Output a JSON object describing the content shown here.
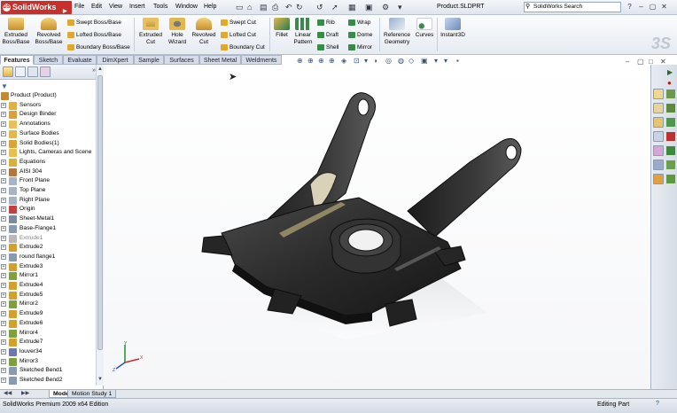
{
  "app": {
    "logo": "SolidWorks",
    "document_title": "Product.SLDPRT"
  },
  "menu": [
    "File",
    "Edit",
    "View",
    "Insert",
    "Tools",
    "Window",
    "Help"
  ],
  "search": {
    "placeholder": "SolidWorks Search"
  },
  "ribbon": {
    "extruded_boss": "Extruded Boss/Base",
    "revolved_boss": "Revolved Boss/Base",
    "swept_boss": "Swept Boss/Base",
    "lofted_boss": "Lofted Boss/Base",
    "boundary_boss": "Boundary Boss/Base",
    "extruded_cut": "Extruded Cut",
    "hole_wizard": "Hole Wizard",
    "revolved_cut": "Revolved Cut",
    "swept_cut": "Swept Cut",
    "lofted_cut": "Lofted Cut",
    "boundary_cut": "Boundary Cut",
    "fillet": "Fillet",
    "linear_pattern": "Linear Pattern",
    "rib": "Rib",
    "draft": "Draft",
    "shell": "Shell",
    "wrap": "Wrap",
    "dome": "Dome",
    "mirror": "Mirror",
    "reference_geometry": "Reference Geometry",
    "curves": "Curves",
    "instant3d": "Instant3D"
  },
  "tabs": [
    "Features",
    "Sketch",
    "Evaluate",
    "DimXpert",
    "Sample",
    "Surfaces",
    "Sheet Metal",
    "Weldments"
  ],
  "tree": [
    {
      "label": "Product  (Product)",
      "icon": "part-icon",
      "color": "#c88a2a",
      "root": true
    },
    {
      "label": "Sensors",
      "icon": "sensor-icon",
      "color": "#e0b040"
    },
    {
      "label": "Design Binder",
      "icon": "binder-icon",
      "color": "#d9a040"
    },
    {
      "label": "Annotations",
      "icon": "annotation-icon",
      "color": "#e6c05a"
    },
    {
      "label": "Surface Bodies",
      "icon": "surface-body-icon",
      "color": "#e2b84c"
    },
    {
      "label": "Solid Bodies(1)",
      "icon": "solid-body-icon",
      "color": "#d9a43c"
    },
    {
      "label": "Lights, Cameras and Scene",
      "icon": "lights-icon",
      "color": "#e5c050"
    },
    {
      "label": "Equations",
      "icon": "equation-icon",
      "color": "#d8b040"
    },
    {
      "label": "AISI 304",
      "icon": "material-icon",
      "color": "#b07840"
    },
    {
      "label": "Front Plane",
      "icon": "plane-icon",
      "color": "#a8b4c4"
    },
    {
      "label": "Top Plane",
      "icon": "plane-icon",
      "color": "#a8b4c4"
    },
    {
      "label": "Right Plane",
      "icon": "plane-icon",
      "color": "#a8b4c4"
    },
    {
      "label": "Origin",
      "icon": "origin-icon",
      "color": "#c04040"
    },
    {
      "label": "Sheet-Metal1",
      "icon": "sheet-metal-icon",
      "color": "#7a8aa0"
    },
    {
      "label": "Base-Flange1",
      "icon": "flange-icon",
      "color": "#8a9ab0"
    },
    {
      "label": "Extrude1",
      "icon": "extrude-icon",
      "color": "#b8b8b8",
      "dim": true
    },
    {
      "label": "Extrude2",
      "icon": "extrude-icon",
      "color": "#d0a030"
    },
    {
      "label": "round flange1",
      "icon": "flange-icon",
      "color": "#8a9ab0"
    },
    {
      "label": "Extrude3",
      "icon": "extrude-icon",
      "color": "#d0a030"
    },
    {
      "label": "Mirror1",
      "icon": "mirror-icon",
      "color": "#7aa040"
    },
    {
      "label": "Extrude4",
      "icon": "extrude-icon",
      "color": "#d0a030"
    },
    {
      "label": "Extrude5",
      "icon": "extrude-icon",
      "color": "#d0a030"
    },
    {
      "label": "Mirror2",
      "icon": "mirror-icon",
      "color": "#7aa040"
    },
    {
      "label": "Extrude9",
      "icon": "extrude-icon",
      "color": "#d0a030"
    },
    {
      "label": "Extrude6",
      "icon": "extrude-icon",
      "color": "#d0a030"
    },
    {
      "label": "Mirror4",
      "icon": "mirror-icon",
      "color": "#7aa040"
    },
    {
      "label": "Extrude7",
      "icon": "extrude-icon",
      "color": "#d0a030"
    },
    {
      "label": "louver34",
      "icon": "louver-icon",
      "color": "#6a7ab0"
    },
    {
      "label": "Mirror3",
      "icon": "mirror-icon",
      "color": "#7aa040"
    },
    {
      "label": "Sketched Bend1",
      "icon": "sketched-bend-icon",
      "color": "#8a9ab0"
    },
    {
      "label": "Sketched Bend2",
      "icon": "sketched-bend-icon",
      "color": "#8a9ab0"
    }
  ],
  "bottom_tabs": [
    "Model",
    "Motion Study 1"
  ],
  "status": {
    "left": "SolidWorks Premium 2009 x64 Edition",
    "right": "Editing Part"
  },
  "colors": {
    "accent": "#c9302c",
    "model": "#2b2b2b",
    "tree_selection": "#3a66b0"
  }
}
